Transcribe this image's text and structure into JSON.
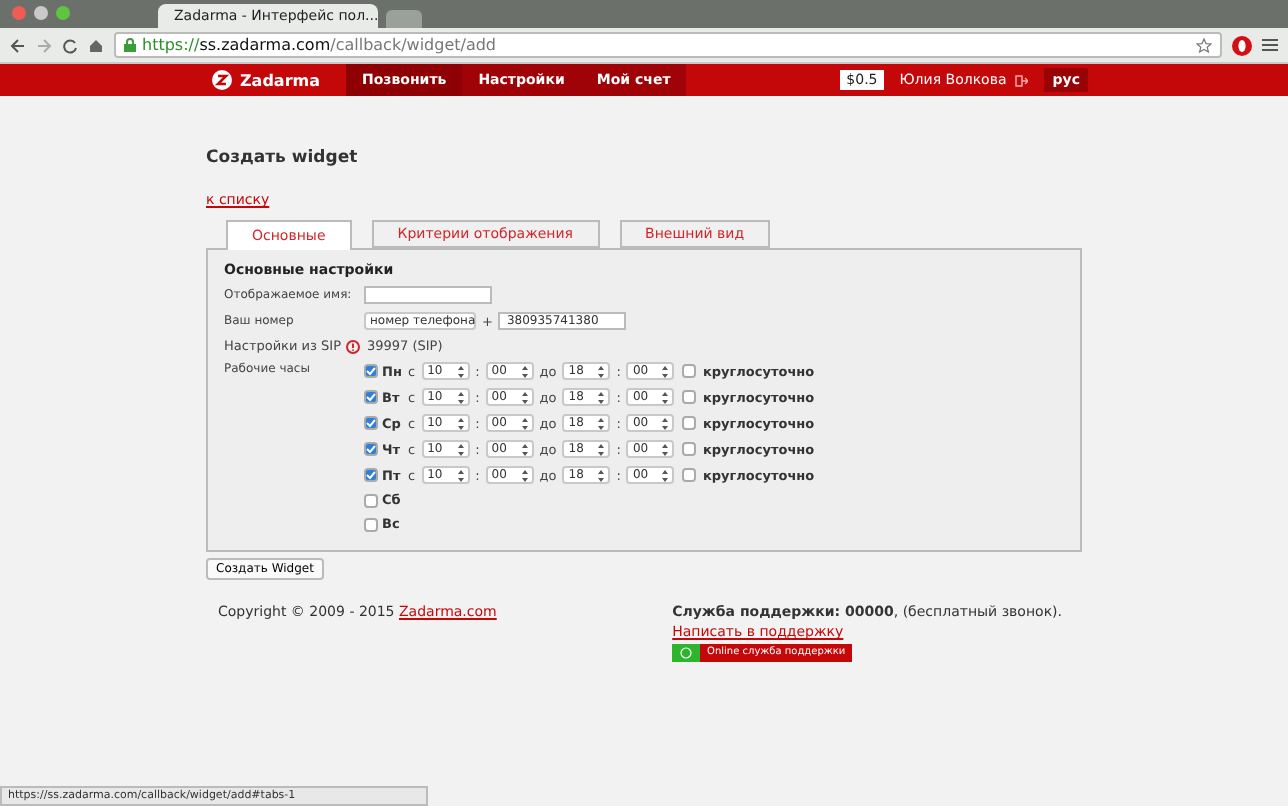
{
  "browser": {
    "tab_title": "Zadarma - Интерфейс пол...",
    "url": {
      "scheme": "https://",
      "host": "ss.zadarma.com",
      "path": "/callback/widget/add"
    }
  },
  "nav": {
    "logo": "Zadarma",
    "items": [
      {
        "label": "Позвонить",
        "selected": true
      },
      {
        "label": "Настройки",
        "selected": false
      },
      {
        "label": "Мой счет",
        "selected": false
      }
    ],
    "balance": "$0.5",
    "user": "Юлия Волкова",
    "language": "рус"
  },
  "page": {
    "title": "Создать widget",
    "back_link": "к списку"
  },
  "tabs": [
    {
      "label": "Основные",
      "selected": true
    },
    {
      "label": "Критерии отображения",
      "selected": false
    },
    {
      "label": "Внешний вид",
      "selected": false
    }
  ],
  "form": {
    "heading": "Основные настройки",
    "name_label": "Отображаемое имя:",
    "number_label": "Ваш номер",
    "number_type": "номер телефона",
    "plus": "+",
    "number": "380935741380",
    "sip_label": "Настройки из SIP",
    "sip_value": "39997 (SIP)",
    "hours_label": "Рабочие часы",
    "days": [
      {
        "day": "Пн",
        "checked": true,
        "from": "с",
        "from_h": "10",
        "sep1": ":",
        "from_m": "00",
        "to": "до",
        "to_h": "18",
        "sep2": ":",
        "to_m": "00",
        "allday": "круглосуточно",
        "allday_checked": false
      },
      {
        "day": "Вт",
        "checked": true,
        "from": "с",
        "from_h": "10",
        "sep1": ":",
        "from_m": "00",
        "to": "до",
        "to_h": "18",
        "sep2": ":",
        "to_m": "00",
        "allday": "круглосуточно",
        "allday_checked": false
      },
      {
        "day": "Ср",
        "checked": true,
        "from": "с",
        "from_h": "10",
        "sep1": ":",
        "from_m": "00",
        "to": "до",
        "to_h": "18",
        "sep2": ":",
        "to_m": "00",
        "allday": "круглосуточно",
        "allday_checked": false
      },
      {
        "day": "Чт",
        "checked": true,
        "from": "с",
        "from_h": "10",
        "sep1": ":",
        "from_m": "00",
        "to": "до",
        "to_h": "18",
        "sep2": ":",
        "to_m": "00",
        "allday": "круглосуточно",
        "allday_checked": false
      },
      {
        "day": "Пт",
        "checked": true,
        "from": "с",
        "from_h": "10",
        "sep1": ":",
        "from_m": "00",
        "to": "до",
        "to_h": "18",
        "sep2": ":",
        "to_m": "00",
        "allday": "круглосуточно",
        "allday_checked": false
      },
      {
        "day": "Сб",
        "checked": false
      },
      {
        "day": "Вс",
        "checked": false
      }
    ]
  },
  "submit": "Создать Widget",
  "footer": {
    "copyright": "Copyright © 2009 - 2015",
    "copyright_link": "Zadarma.com",
    "support": "**Служба поддержки: 00000**, (бесплатный звонок).",
    "support_link": "Написать в поддержку",
    "online_button": "Online служба поддержки"
  },
  "status_bar": "https://ss.zadarma.com/callback/widget/add#tabs-1"
}
